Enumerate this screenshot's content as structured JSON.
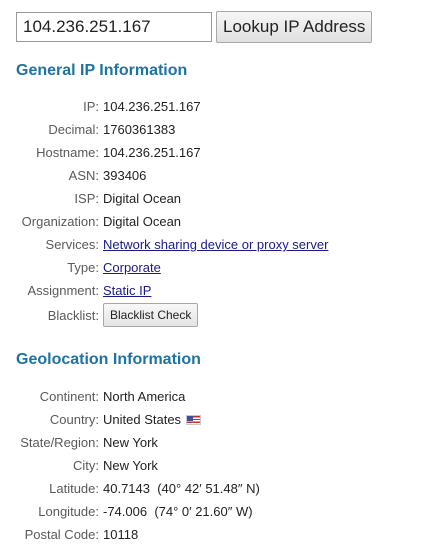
{
  "search": {
    "value": "104.236.251.167",
    "button_label": "Lookup IP Address"
  },
  "general": {
    "title": "General IP Information",
    "ip_label": "IP:",
    "ip_value": "104.236.251.167",
    "decimal_label": "Decimal:",
    "decimal_value": "1760361383",
    "hostname_label": "Hostname:",
    "hostname_value": "104.236.251.167",
    "asn_label": "ASN:",
    "asn_value": "393406",
    "isp_label": "ISP:",
    "isp_value": "Digital Ocean",
    "org_label": "Organization:",
    "org_value": "Digital Ocean",
    "services_label": "Services:",
    "services_value": "Network sharing device or proxy server",
    "type_label": "Type:",
    "type_value": "Corporate",
    "assignment_label": "Assignment:",
    "assignment_value": "Static IP",
    "blacklist_label": "Blacklist:",
    "blacklist_button": "Blacklist Check"
  },
  "geo": {
    "title": "Geolocation Information",
    "continent_label": "Continent:",
    "continent_value": "North America",
    "country_label": "Country:",
    "country_value": "United States",
    "country_flag_icon": "us-flag-icon",
    "state_label": "State/Region:",
    "state_value": "New York",
    "city_label": "City:",
    "city_value": "New York",
    "latitude_label": "Latitude:",
    "latitude_value": "40.7143  (40° 42′ 51.48″ N)",
    "longitude_label": "Longitude:",
    "longitude_value": "-74.006  (74° 0′ 21.60″ W)",
    "postal_label": "Postal Code:",
    "postal_value": "10118"
  },
  "colors": {
    "section_title": "#1f73a0",
    "link": "#1a1a8c",
    "label": "#5a5a5a"
  }
}
